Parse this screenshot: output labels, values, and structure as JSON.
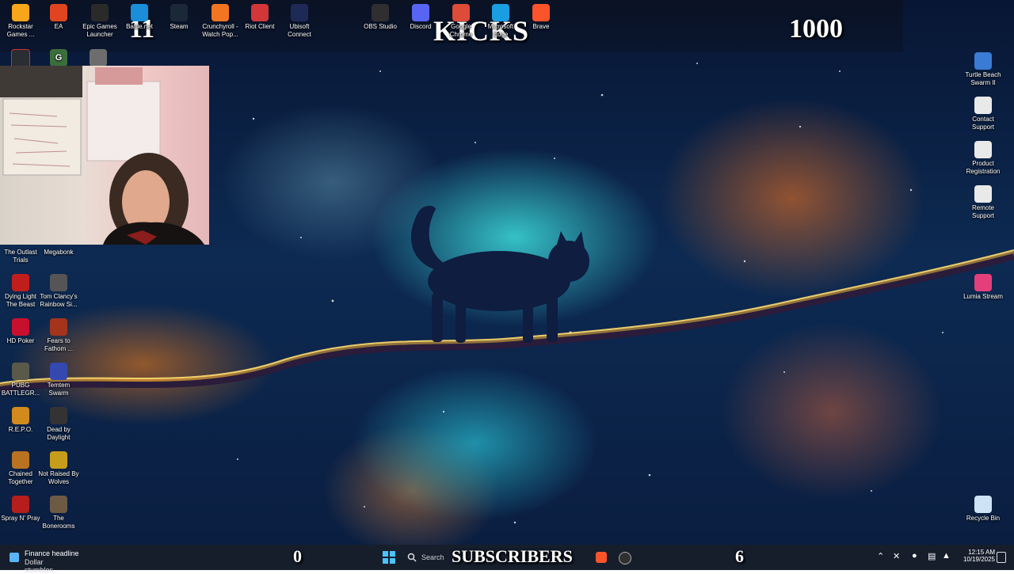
{
  "overlay": {
    "count_left": "11",
    "kicks_label": "KICKS",
    "kicks_goal": "1000",
    "subs_count": "0",
    "subs_label": "SUBSCRIBERS",
    "subs_goal": "6"
  },
  "top_icons": [
    {
      "label": "Rockstar Games ...",
      "color": "#f7a61a",
      "icon": "rockstar-icon"
    },
    {
      "label": "EA",
      "color": "#e0451f",
      "icon": "ea-icon"
    },
    {
      "label": "Epic Games Launcher",
      "color": "#2a2a2a",
      "icon": "epic-games-icon"
    },
    {
      "label": "Battle.net",
      "color": "#1a8ed8",
      "icon": "battlenet-icon"
    },
    {
      "label": "Steam",
      "color": "#1b2838",
      "icon": "steam-icon"
    },
    {
      "label": "Crunchyroll - Watch Pop...",
      "color": "#f47521",
      "icon": "crunchyroll-icon"
    },
    {
      "label": "Riot Client",
      "color": "#d13639",
      "icon": "riot-icon"
    },
    {
      "label": "Ubisoft Connect",
      "color": "#1e2a55",
      "icon": "ubisoft-icon"
    },
    {
      "label": "OBS Studio",
      "color": "#302e31",
      "icon": "obs-icon"
    },
    {
      "label": "Discord",
      "color": "#5865f2",
      "icon": "discord-icon"
    },
    {
      "label": "Google Chrome",
      "color": "#dd4b39",
      "icon": "chrome-icon"
    },
    {
      "label": "Microsoft Edge",
      "color": "#1b9de2",
      "icon": "edge-icon"
    },
    {
      "label": "Brave",
      "color": "#fb542b",
      "icon": "brave-icon"
    }
  ],
  "left_icons": [
    {
      "label": "The Outlast Trials",
      "color": "#3a3a3a",
      "icon": "outlast-icon"
    },
    {
      "label": "Megabonk",
      "color": "#444",
      "icon": "megabonk-icon"
    },
    {
      "label": "Dying Light The Beast",
      "color": "#c01d1d",
      "icon": "dying-light-icon"
    },
    {
      "label": "Tom Clancy's Rainbow Si...",
      "color": "#555",
      "icon": "rainbow-six-icon"
    },
    {
      "label": "HD Poker",
      "color": "#c8102e",
      "icon": "hd-poker-icon"
    },
    {
      "label": "Fears to Fathom ...",
      "color": "#a5341d",
      "icon": "fears-to-fathom-icon"
    },
    {
      "label": "PUBG BATTLEGR...",
      "color": "#5a5a4a",
      "icon": "pubg-icon"
    },
    {
      "label": "Temtem Swarm",
      "color": "#3548b0",
      "icon": "temtem-icon"
    },
    {
      "label": "R.E.P.O.",
      "color": "#d28a1c",
      "icon": "repo-icon"
    },
    {
      "label": "Dead by Daylight",
      "color": "#333",
      "icon": "dead-by-daylight-icon"
    },
    {
      "label": "Chained Together",
      "color": "#b9721f",
      "icon": "chained-together-icon"
    },
    {
      "label": "Not Raised By Wolves",
      "color": "#c59d1b",
      "icon": "not-raised-by-wolves-icon"
    },
    {
      "label": "Spray N' Pray",
      "color": "#b61d1d",
      "icon": "spray-n-pray-icon"
    },
    {
      "label": "The Bonerooms",
      "color": "#6d5a45",
      "icon": "bonerooms-icon"
    }
  ],
  "right_icons": [
    {
      "label": "Turtle Beach Swarm II",
      "color": "#3a7bd5",
      "icon": "turtle-beach-icon"
    },
    {
      "label": "Contact Support",
      "color": "#e9e9e9",
      "icon": "contact-support-icon"
    },
    {
      "label": "Product Registration",
      "color": "#e9e9e9",
      "icon": "product-registration-icon"
    },
    {
      "label": "Remote Support",
      "color": "#e9e9e9",
      "icon": "remote-support-icon"
    },
    {
      "label": "Lumia Stream",
      "color": "#e43f7a",
      "icon": "lumia-stream-icon"
    },
    {
      "label": "Recycle Bin",
      "color": "#cde3f5",
      "icon": "recycle-bin-icon"
    }
  ],
  "taskbar": {
    "widget_title": "Finance headline",
    "widget_sub": "Dollar stumbles...",
    "search_placeholder": "Search",
    "time": "12:15 AM",
    "date": "10/19/2025"
  },
  "colors": {
    "taskbar": "#181e2a",
    "accent": "#0078d4"
  }
}
